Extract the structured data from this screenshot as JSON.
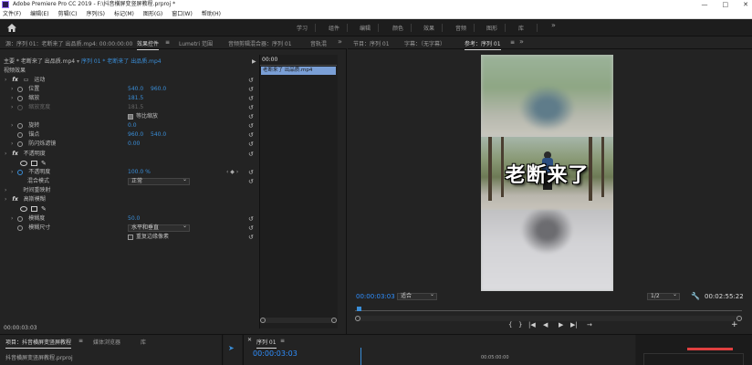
{
  "titlebar": {
    "title": "Adobe Premiere Pro CC 2019 - F:\\抖音横屏变竖屏教程.prproj *",
    "minimize": "—",
    "maximize": "□",
    "close": "✕"
  },
  "menu": [
    "文件(F)",
    "编辑(E)",
    "剪辑(C)",
    "序列(S)",
    "标记(M)",
    "图形(G)",
    "窗口(W)",
    "帮助(H)"
  ],
  "workspace": {
    "home_icon": "home-icon",
    "tabs": [
      "学习",
      "组件",
      "编辑",
      "颜色",
      "效果",
      "音频",
      "图形",
      "库"
    ],
    "more": "»"
  },
  "left_panel": {
    "tabs": [
      "源：序列 01：老断来了 出品质.mp4: 00:00:00:00",
      "效果控件",
      "Lumetri 范围",
      "音频剪辑混合器：序列 01",
      "音轨混",
      "»"
    ],
    "clip_header": "主要 * 老断来了 出品质.mp4",
    "clip_link": "序列 01 * 老断来了 出品质.mp4",
    "mini_clip_label": "老断来了 出品质.mp4",
    "mini_timecode": "00:00",
    "section_video": "视频效果",
    "motion": "运动",
    "position": {
      "label": "位置",
      "x": "540.0",
      "y": "960.0"
    },
    "scale": {
      "label": "缩放",
      "value": "181.5"
    },
    "scale_width": {
      "label": "缩放宽度",
      "value": "181.5"
    },
    "uniform_scale": "等比缩放",
    "rotation": {
      "label": "旋转",
      "value": "0.0"
    },
    "anchor": {
      "label": "锚点",
      "x": "960.0",
      "y": "540.0"
    },
    "antiflicker": {
      "label": "防闪烁滤镜",
      "value": "0.00"
    },
    "opacity": "不透明度",
    "opacity_value": {
      "label": "不透明度",
      "value": "100.0 %"
    },
    "blend_mode": {
      "label": "混合模式",
      "value": "正常"
    },
    "time_remap": "时间重映射",
    "gaussian_blur": "高斯模糊",
    "blurriness": {
      "label": "模糊度",
      "value": "50.0"
    },
    "blur_dims": {
      "label": "模糊尺寸",
      "value": "水平和垂直"
    },
    "repeat_edge": "重复边缘像素",
    "bottom_timecode": "00:00:03:03"
  },
  "program_panel": {
    "tabs": [
      "节目：序列 01",
      "字幕：（无字幕）",
      "参考：序列 01",
      "»"
    ],
    "overlay_text": "老断来了",
    "timecode": "00:00:03:03",
    "fit": "适合",
    "quality": "1/2",
    "duration": "00:02:55:22",
    "controls": [
      "{",
      "}",
      "|◀",
      "◀",
      "▶",
      "▶|",
      "→"
    ]
  },
  "bottom": {
    "project_tabs": [
      "项目：抖音横屏变竖屏教程",
      "媒体浏览器",
      "库"
    ],
    "project_file": "抖音横屏变竖屏教程.prproj",
    "sequence_tab": "序列 01",
    "sequence_timecode": "00:00:03:03",
    "ruler_label": "00:05:00:00"
  },
  "colors": {
    "accent_blue": "#2f8fff",
    "clip_blue": "#7a9fd6",
    "meter_red": "#e04040"
  }
}
